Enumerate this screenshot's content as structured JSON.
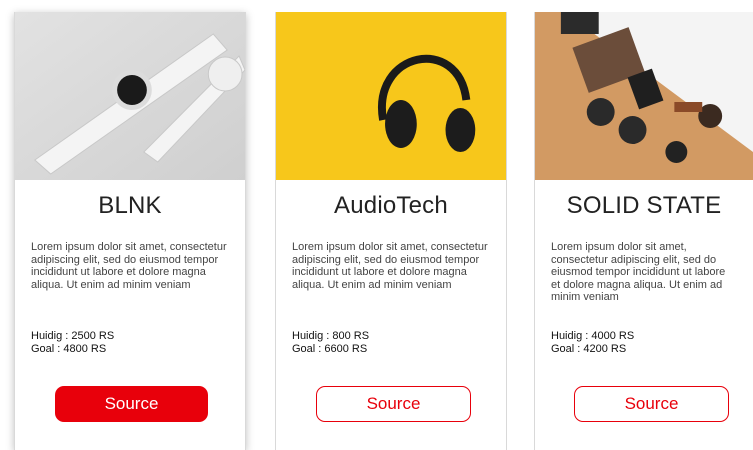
{
  "cards": [
    {
      "title": "BLNK",
      "description": "Lorem ipsum dolor sit amet, consectetur adipiscing elit, sed do eiusmod tempor incididunt ut labore et dolore magna aliqua. Ut enim ad minim veniam",
      "huidig": "Huidig : 2500 RS",
      "goal": "Goal : 4800 RS",
      "button": "Source",
      "image": "white-smartwatches-photo"
    },
    {
      "title": "AudioTech",
      "description": "Lorem ipsum dolor sit amet, consectetur adipiscing elit, sed do eiusmod tempor incididunt ut labore et dolore magna aliqua. Ut enim ad minim veniam",
      "huidig": "Huidig : 800 RS",
      "goal": "Goal : 6600 RS",
      "button": "Source",
      "image": "headphones-on-yellow-photo"
    },
    {
      "title": "SOLID STATE",
      "description": "Lorem ipsum dolor sit amet, consectetur adipiscing elit, sed do eiusmod tempor incididunt ut labore et dolore magna aliqua. Ut enim ad minim veniam",
      "huidig": "Huidig : 4000 RS",
      "goal": "Goal : 4200 RS",
      "button": "Source",
      "image": "sunglasses-and-watches-photo"
    }
  ],
  "colors": {
    "accent": "#e8000b",
    "yellow": "#f7c71b"
  }
}
